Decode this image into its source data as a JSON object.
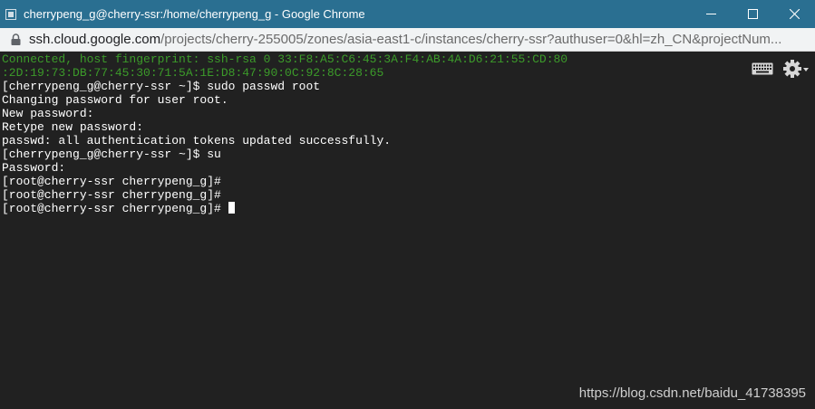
{
  "window": {
    "title": "cherrypeng_g@cherry-ssr:/home/cherrypeng_g - Google Chrome",
    "title_bar_color": "#2a6f91"
  },
  "address_bar": {
    "host": "ssh.cloud.google.com",
    "path": "/projects/cherry-255005/zones/asia-east1-c/instances/cherry-ssr?authuser=0&hl=zh_CN&projectNum..."
  },
  "terminal": {
    "background": "#212121",
    "lines": [
      {
        "text": "Connected, host fingerprint: ssh-rsa 0 33:F8:A5:C6:45:3A:F4:AB:4A:D6:21:55:CD:80",
        "style": "green"
      },
      {
        "text": ":2D:19:73:DB:77:45:30:71:5A:1E:D8:47:90:0C:92:8C:28:65",
        "style": "green"
      },
      {
        "text": "[cherrypeng_g@cherry-ssr ~]$ sudo passwd root",
        "style": "normal"
      },
      {
        "text": "Changing password for user root.",
        "style": "normal"
      },
      {
        "text": "New password:",
        "style": "normal"
      },
      {
        "text": "Retype new password:",
        "style": "normal"
      },
      {
        "text": "passwd: all authentication tokens updated successfully.",
        "style": "normal"
      },
      {
        "text": "[cherrypeng_g@cherry-ssr ~]$ su",
        "style": "normal"
      },
      {
        "text": "Password:",
        "style": "normal"
      },
      {
        "text": "[root@cherry-ssr cherrypeng_g]#",
        "style": "normal"
      },
      {
        "text": "[root@cherry-ssr cherrypeng_g]#",
        "style": "normal"
      },
      {
        "text": "[root@cherry-ssr cherrypeng_g]#",
        "style": "normal"
      }
    ],
    "tools": {
      "keyboard_icon": "keyboard-icon",
      "settings_icon": "gear-icon"
    }
  },
  "watermark": "https://blog.csdn.net/baidu_41738395"
}
